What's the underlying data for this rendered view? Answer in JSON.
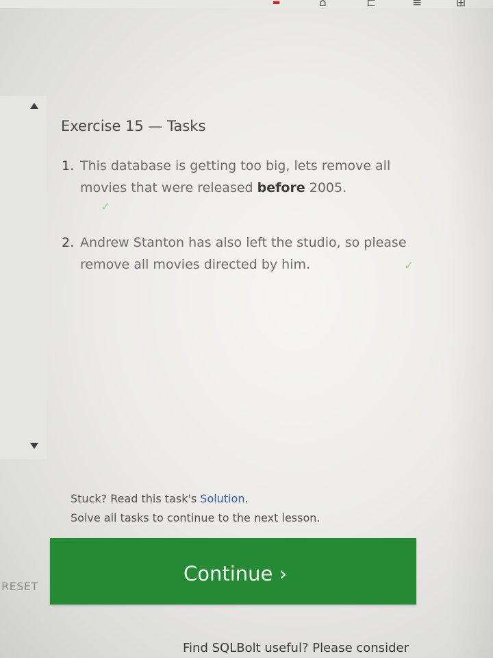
{
  "top_icons": [
    "red-badge-icon",
    "tool-icon",
    "split-icon",
    "list-icon",
    "add-icon"
  ],
  "exercise": {
    "title": "Exercise 15 — Tasks",
    "tasks": [
      {
        "number": "1.",
        "text_before": "This database is getting too big, lets remove all movies that were released ",
        "bold": "before",
        "text_after": " 2005.",
        "status": "done"
      },
      {
        "number": "2.",
        "text": "Andrew Stanton has also left the studio, so please remove all movies directed by him.",
        "status": "done"
      }
    ],
    "check_symbol": "✓"
  },
  "footer": {
    "stuck_text": "Stuck? Read this task's ",
    "solution_link": "Solution",
    "stuck_end": ".",
    "continue_note": "Solve all tasks to continue to the next lesson."
  },
  "buttons": {
    "continue_label": "Continue ›",
    "reset_label": "RESET"
  },
  "bottom_text": "Find SQLBolt useful? Please consider",
  "colors": {
    "continue_bg": "#248a33",
    "link": "#2f5fa8",
    "check": "#9ccf8f"
  }
}
